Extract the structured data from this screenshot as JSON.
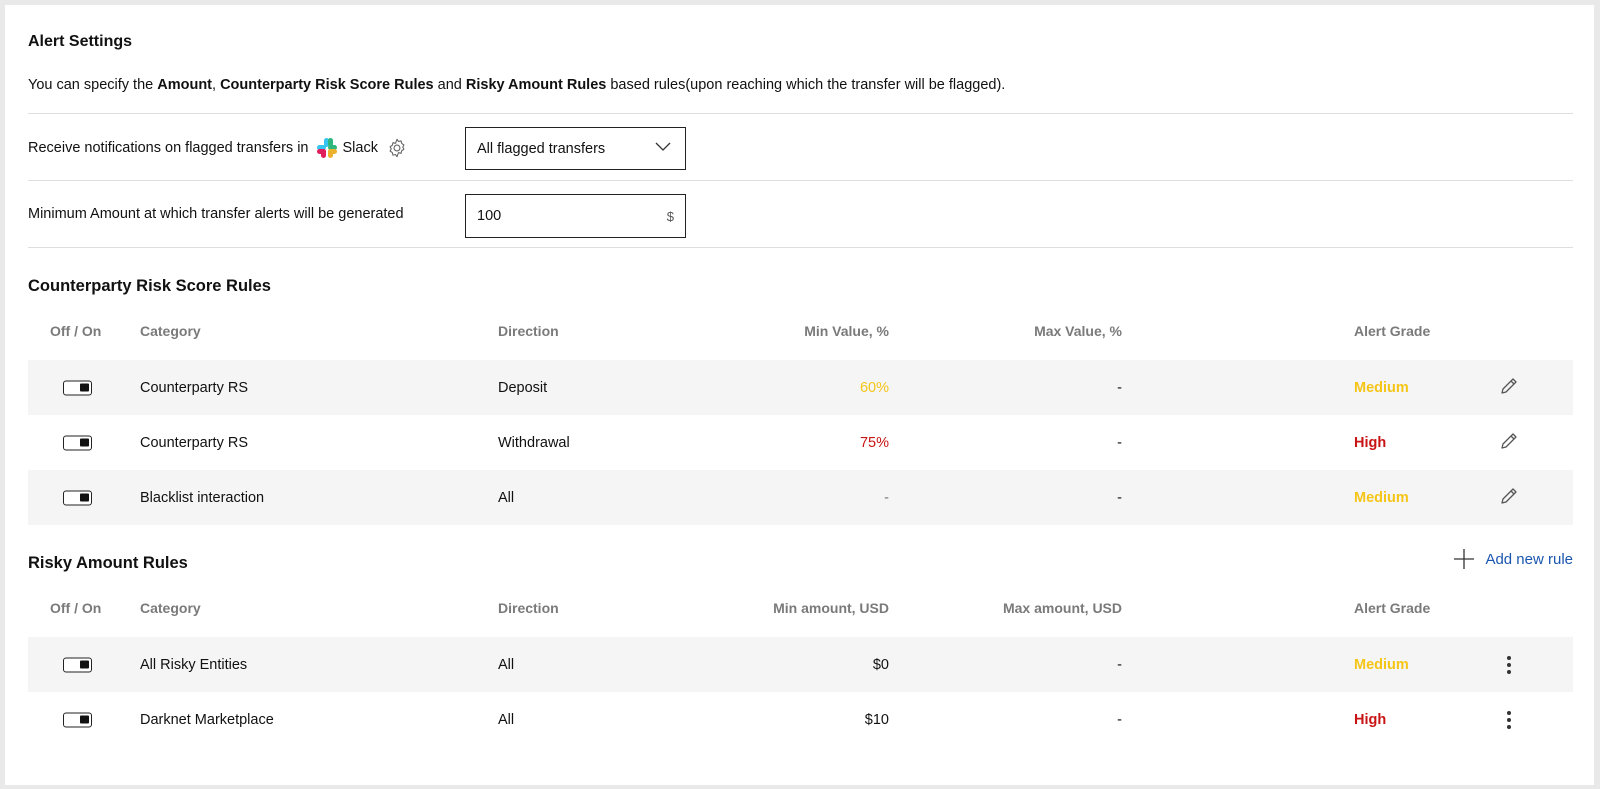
{
  "header": {
    "title": "Alert Settings",
    "desc_intro": "You can specify the ",
    "desc_amount": "Amount",
    "desc_sep1": ", ",
    "desc_crs": "Counterparty Risk Score Rules",
    "desc_and": " and ",
    "desc_rar": "Risky Amount Rules",
    "desc_end": " based rules(upon reaching which the transfer will be flagged)."
  },
  "notifications": {
    "label": "Receive notifications on flagged transfers in",
    "app_name": "Slack",
    "selected": "All flagged transfers"
  },
  "minimum_amount": {
    "label": "Minimum Amount at which transfer alerts will be generated",
    "value": "100",
    "unit": "$"
  },
  "counterparty_rules": {
    "title": "Counterparty Risk Score Rules",
    "headers": {
      "toggle": "Off / On",
      "category": "Category",
      "direction": "Direction",
      "min": "Min Value, %",
      "max": "Max Value, %",
      "grade": "Alert Grade"
    },
    "rows": [
      {
        "category": "Counterparty RS",
        "direction": "Deposit",
        "min": "60%",
        "max": "-",
        "grade": "Medium",
        "enabled": true,
        "min_color": "#f5c518",
        "grade_color": "#f5c518"
      },
      {
        "category": "Counterparty RS",
        "direction": "Withdrawal",
        "min": "75%",
        "max": "-",
        "grade": "High",
        "enabled": true,
        "min_color": "#c81414",
        "grade_color": "#c81414"
      },
      {
        "category": "Blacklist interaction",
        "direction": "All",
        "min": "-",
        "max": "-",
        "grade": "Medium",
        "enabled": true,
        "min_color": "#777777",
        "grade_color": "#f5c518"
      }
    ]
  },
  "risky_amount_rules": {
    "title": "Risky Amount Rules",
    "add_label": "Add new rule",
    "headers": {
      "toggle": "Off / On",
      "category": "Category",
      "direction": "Direction",
      "min": "Min amount, USD",
      "max": "Max amount, USD",
      "grade": "Alert Grade"
    },
    "rows": [
      {
        "category": "All Risky Entities",
        "direction": "All",
        "min": "$0",
        "max": "-",
        "grade": "Medium",
        "enabled": true,
        "grade_color": "#f5c518"
      },
      {
        "category": "Darknet Marketplace",
        "direction": "All",
        "min": "$10",
        "max": "-",
        "grade": "High",
        "enabled": true,
        "grade_color": "#c81414"
      }
    ]
  },
  "colors": {
    "accent": "#1a56b0",
    "medium": "#f5c518",
    "high": "#c81414"
  }
}
